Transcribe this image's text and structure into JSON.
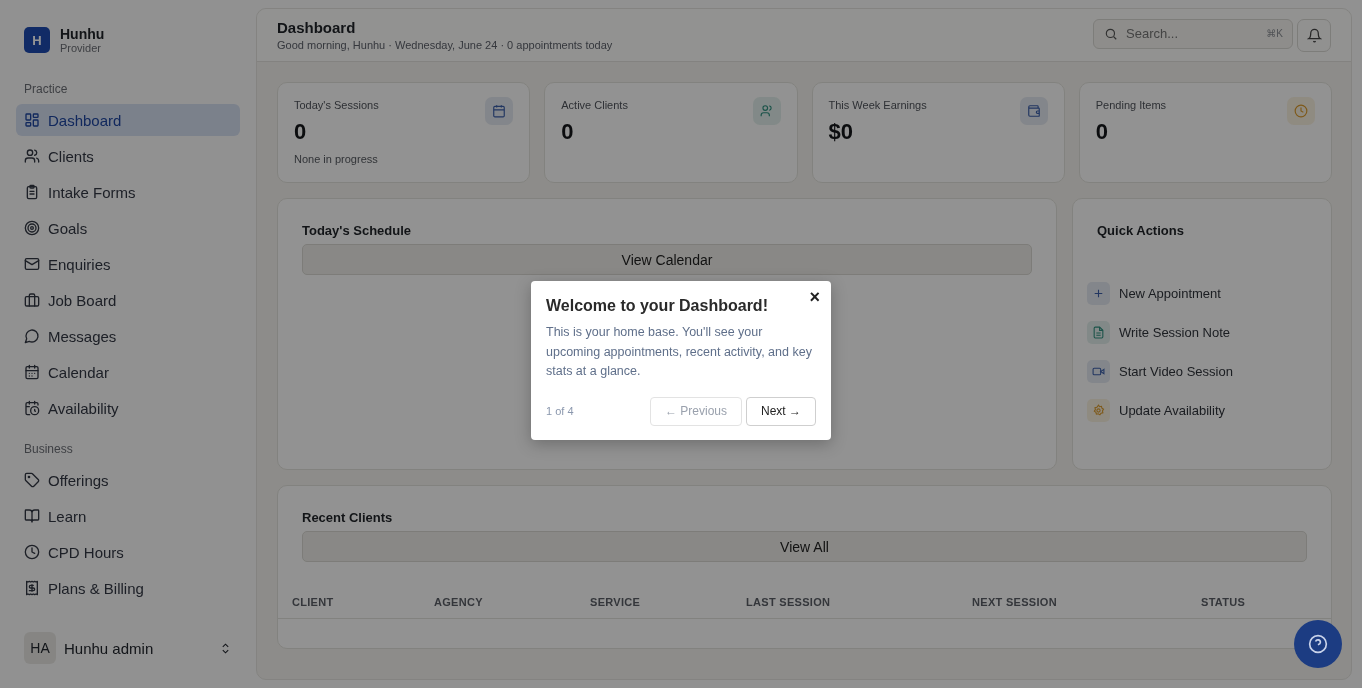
{
  "brand": {
    "initial": "H",
    "name": "Hunhu",
    "role": "Provider"
  },
  "sidebar": {
    "sections": [
      {
        "title": "Practice",
        "items": [
          {
            "label": "Dashboard",
            "selected": true
          },
          {
            "label": "Clients",
            "selected": false
          },
          {
            "label": "Intake Forms",
            "selected": false
          },
          {
            "label": "Goals",
            "selected": false
          },
          {
            "label": "Enquiries",
            "selected": false
          },
          {
            "label": "Job Board",
            "selected": false
          },
          {
            "label": "Messages",
            "selected": false
          },
          {
            "label": "Calendar",
            "selected": false
          },
          {
            "label": "Availability",
            "selected": false
          }
        ]
      },
      {
        "title": "Business",
        "items": [
          {
            "label": "Offerings",
            "selected": false
          },
          {
            "label": "Learn",
            "selected": false
          },
          {
            "label": "CPD Hours",
            "selected": false
          },
          {
            "label": "Plans & Billing",
            "selected": false
          }
        ]
      }
    ],
    "user": {
      "initials": "HA",
      "name": "Hunhu admin"
    }
  },
  "header": {
    "title": "Dashboard",
    "subtitle": "Good morning, Hunhu · Wednesday, June 24 · 0 appointments today",
    "search": {
      "placeholder": "Search...",
      "shortcut": "⌘K"
    }
  },
  "stats": [
    {
      "label": "Today's Sessions",
      "value": "0",
      "note": "None in progress"
    },
    {
      "label": "Active Clients",
      "value": "0"
    },
    {
      "label": "This Week Earnings",
      "value": "$0"
    },
    {
      "label": "Pending Items",
      "value": "0"
    }
  ],
  "schedule": {
    "title": "Today's Schedule",
    "button": "View Calendar"
  },
  "quick_actions": {
    "title": "Quick Actions",
    "items": [
      {
        "label": "New Appointment"
      },
      {
        "label": "Write Session Note"
      },
      {
        "label": "Start Video Session"
      },
      {
        "label": "Update Availability"
      }
    ]
  },
  "recent_clients": {
    "title": "Recent Clients",
    "button": "View All",
    "columns": [
      "CLIENT",
      "AGENCY",
      "SERVICE",
      "LAST SESSION",
      "NEXT SESSION",
      "STATUS"
    ]
  },
  "tour": {
    "title": "Welcome to your Dashboard!",
    "body": "This is your home base. You'll see your upcoming appointments, recent activity, and key stats at a glance.",
    "close": "×",
    "step": "1 of 4",
    "previous": {
      "label": "← Previous",
      "disabled": true
    },
    "next": {
      "label": "Next →",
      "disabled": false
    }
  }
}
